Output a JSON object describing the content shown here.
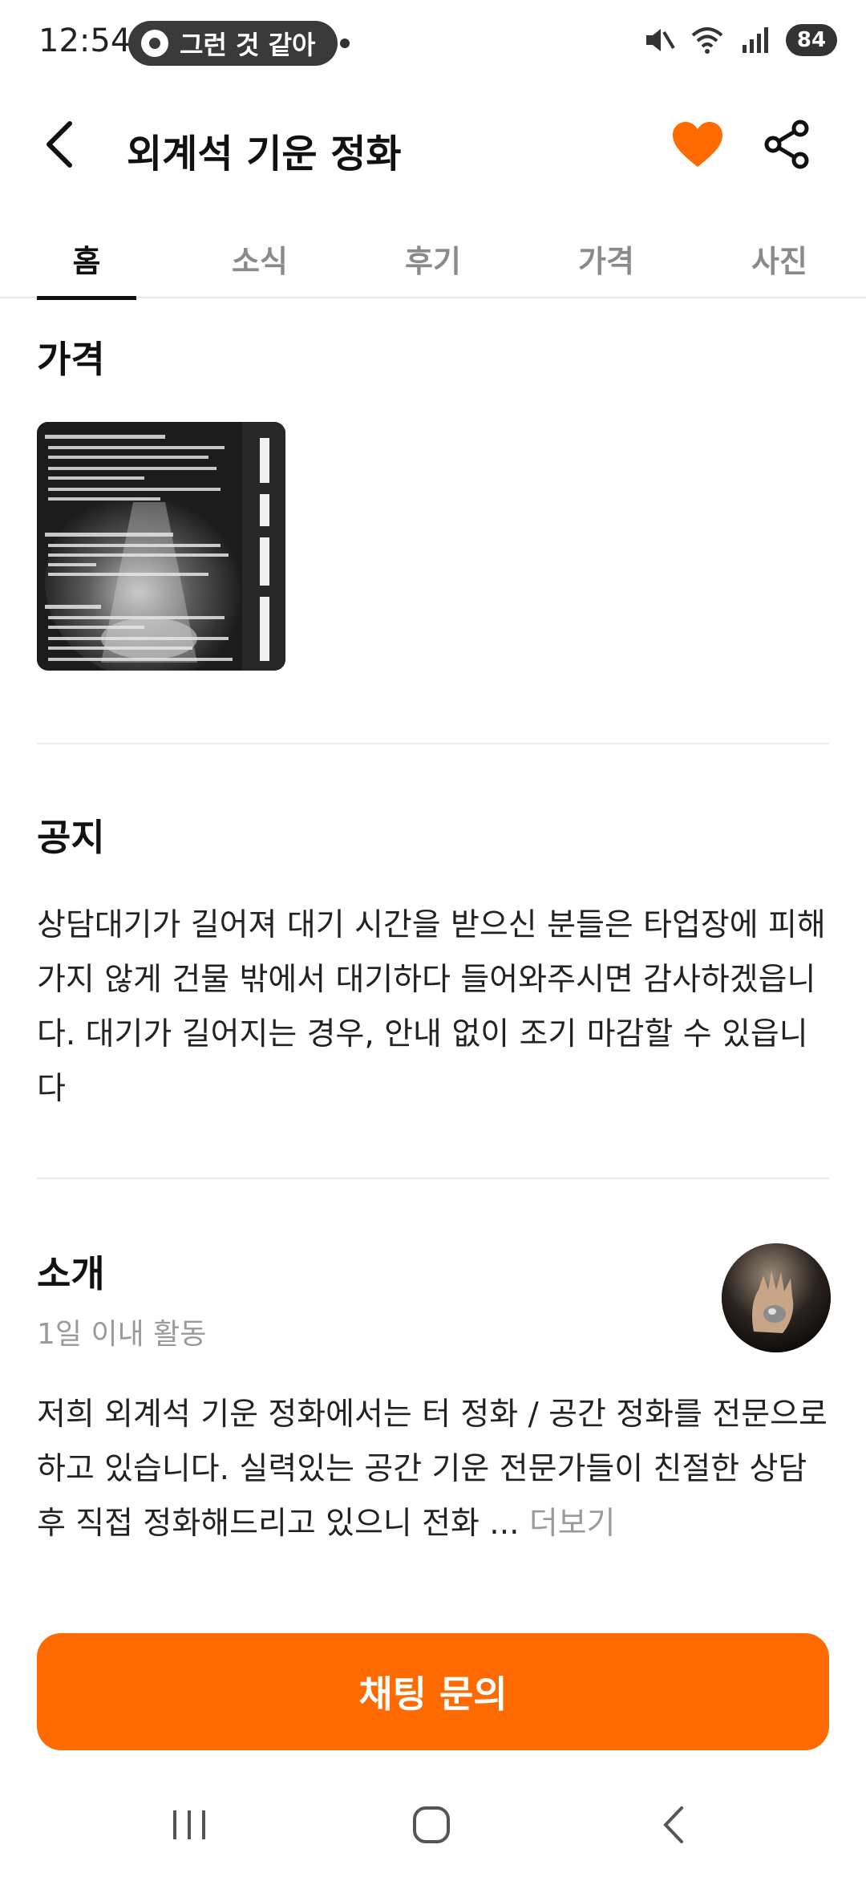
{
  "status_bar": {
    "time": "12:54",
    "now_playing": "그런 것 같아",
    "battery": "84"
  },
  "header": {
    "title": "외계석 기운 정화"
  },
  "colors": {
    "accent": "#ff6b00",
    "text": "#1a1a1a",
    "muted": "#9a9a9a"
  },
  "tabs": [
    {
      "label": "홈",
      "active": true
    },
    {
      "label": "소식",
      "active": false
    },
    {
      "label": "후기",
      "active": false
    },
    {
      "label": "가격",
      "active": false
    },
    {
      "label": "사진",
      "active": false
    }
  ],
  "price": {
    "heading": "가격"
  },
  "notice": {
    "heading": "공지",
    "body": "상담대기가 길어져 대기 시간을 받으신 분들은 타업장에 피해 가지 않게 건물 밖에서 대기하다 들어와주시면 감사하겠읍니다. 대기가 길어지는 경우, 안내 없이 조기 마감할 수 있읍니다"
  },
  "intro": {
    "heading": "소개",
    "activity": "1일 이내 활동",
    "body": "저희 외계석 기운 정화에서는 터 정화 / 공간 정화를 전문으로 하고 있습니다. 실력있는 공간 기운 전문가들이 친절한 상담 후 직접 정화해드리고 있으니 전화 ...",
    "more": "더보기"
  },
  "cta": {
    "label": "채팅 문의"
  },
  "icons": {
    "back": "chevron-left-icon",
    "heart": "heart-icon",
    "share": "share-icon"
  }
}
